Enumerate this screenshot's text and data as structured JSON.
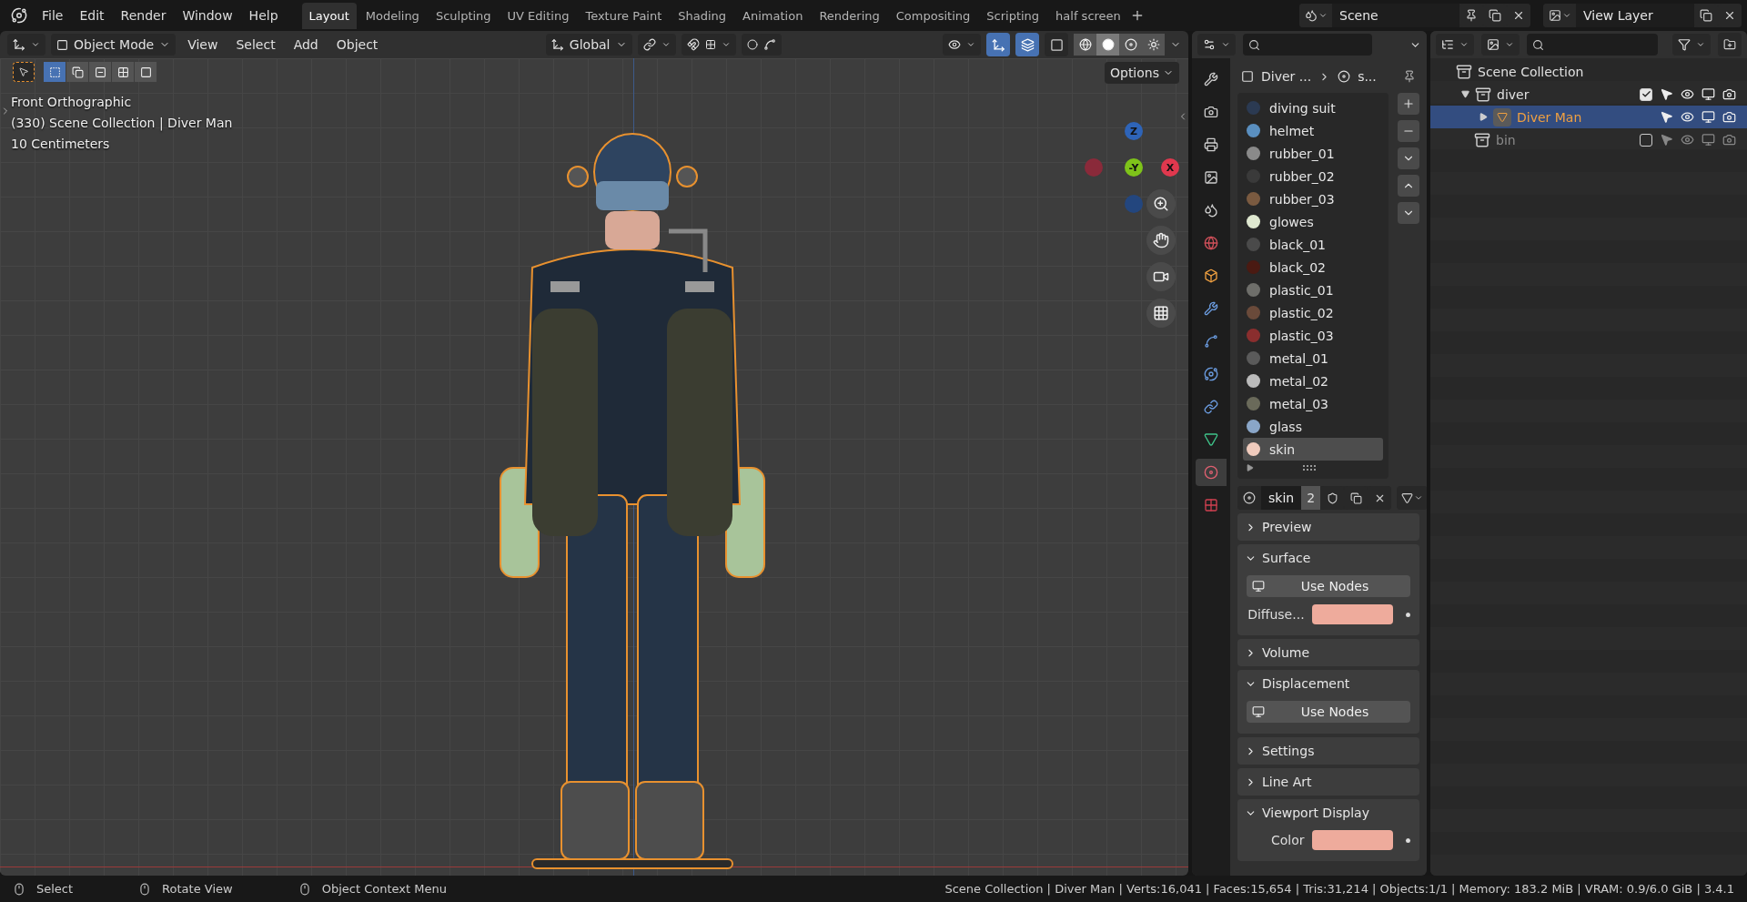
{
  "menu": [
    "File",
    "Edit",
    "Render",
    "Window",
    "Help"
  ],
  "workspaces": [
    {
      "label": "Layout",
      "selected": true
    },
    {
      "label": "Modeling",
      "selected": false
    },
    {
      "label": "Sculpting",
      "selected": false
    },
    {
      "label": "UV Editing",
      "selected": false
    },
    {
      "label": "Texture Paint",
      "selected": false
    },
    {
      "label": "Shading",
      "selected": false
    },
    {
      "label": "Animation",
      "selected": false
    },
    {
      "label": "Rendering",
      "selected": false
    },
    {
      "label": "Compositing",
      "selected": false
    },
    {
      "label": "Scripting",
      "selected": false
    },
    {
      "label": "half screen",
      "selected": false
    }
  ],
  "scene": {
    "name": "Scene"
  },
  "view_layer": {
    "name": "View Layer"
  },
  "viewport": {
    "mode": "Object Mode",
    "menus": [
      "View",
      "Select",
      "Add",
      "Object"
    ],
    "orientation": "Global",
    "toggles": [
      {
        "kind": "gizmo",
        "on": true
      },
      {
        "kind": "overlay",
        "on": true
      },
      {
        "kind": "xray",
        "on": false
      }
    ],
    "shading_modes": [
      {
        "kind": "wireframe",
        "selected": false
      },
      {
        "kind": "solid",
        "selected": true
      },
      {
        "kind": "material",
        "selected": false
      },
      {
        "kind": "rendered",
        "selected": false
      }
    ],
    "select_modes": [
      {
        "kind": "set",
        "selected": true
      },
      {
        "kind": "extend",
        "selected": false
      },
      {
        "kind": "subtract",
        "selected": false
      },
      {
        "kind": "invert",
        "selected": false
      },
      {
        "kind": "intersect",
        "selected": false
      }
    ],
    "options": "Options",
    "overlay_text": [
      "Front Orthographic",
      "(330) Scene Collection | Diver Man",
      "10 Centimeters"
    ],
    "gizmo": {
      "z": "Z",
      "y": "-Y",
      "x": "X"
    }
  },
  "properties": {
    "breadcrumb": [
      "Diver ...",
      "s..."
    ],
    "materials": [
      {
        "name": "diving suit",
        "color": "#2b3a52",
        "selected": false
      },
      {
        "name": "helmet",
        "color": "#5a8fc0",
        "selected": false
      },
      {
        "name": "rubber_01",
        "color": "#8a8a8a",
        "selected": false
      },
      {
        "name": "rubber_02",
        "color": "#3a3a3a",
        "selected": false
      },
      {
        "name": "rubber_03",
        "color": "#7a5a40",
        "selected": false
      },
      {
        "name": "glowes",
        "color": "#dfe8d0",
        "selected": false
      },
      {
        "name": "black_01",
        "color": "#4a4a4a",
        "selected": false
      },
      {
        "name": "black_02",
        "color": "#4a1a12",
        "selected": false
      },
      {
        "name": "plastic_01",
        "color": "#6e6e6a",
        "selected": false
      },
      {
        "name": "plastic_02",
        "color": "#6a4a3a",
        "selected": false
      },
      {
        "name": "plastic_03",
        "color": "#8a2e2e",
        "selected": false
      },
      {
        "name": "metal_01",
        "color": "#5a5a5a",
        "selected": false
      },
      {
        "name": "metal_02",
        "color": "#bbbbbb",
        "selected": false
      },
      {
        "name": "metal_03",
        "color": "#6a6a5a",
        "selected": false
      },
      {
        "name": "glass",
        "color": "#8aa6c8",
        "selected": false
      },
      {
        "name": "skin",
        "color": "#f0cbbd",
        "selected": true
      }
    ],
    "material_name": "skin",
    "users": "2",
    "panels": [
      {
        "title": "Preview",
        "expanded": false
      },
      {
        "title": "Surface",
        "expanded": true,
        "rows": [
          {
            "kind": "button",
            "label": "Use Nodes"
          },
          {
            "kind": "color",
            "label": "Diffuse...",
            "color": "#eeab9c"
          }
        ]
      },
      {
        "title": "Volume",
        "expanded": false
      },
      {
        "title": "Displacement",
        "expanded": true,
        "rows": [
          {
            "kind": "button",
            "label": "Use Nodes"
          }
        ]
      },
      {
        "title": "Settings",
        "expanded": false
      },
      {
        "title": "Line Art",
        "expanded": false
      },
      {
        "title": "Viewport Display",
        "expanded": true,
        "rows": [
          {
            "kind": "color",
            "label": "Color",
            "color": "#eeab9c"
          }
        ]
      }
    ]
  },
  "outliner": {
    "items": [
      {
        "name": "Scene Collection",
        "children": [
          {
            "name": "diver",
            "expanded": true,
            "checked": true,
            "children": [
              {
                "name": "Diver Man",
                "expanded": false,
                "selected": true
              }
            ]
          },
          {
            "name": "bin",
            "checked": false
          }
        ]
      }
    ]
  },
  "status_bar": {
    "hints": [
      "Select",
      "Rotate View",
      "Object Context Menu"
    ],
    "stats": "Scene Collection | Diver Man | Verts:16,041 | Faces:15,654 | Tris:31,214 | Objects:1/1 | Memory: 183.2 MiB | VRAM: 0.9/6.0 GiB | 3.4.1"
  }
}
